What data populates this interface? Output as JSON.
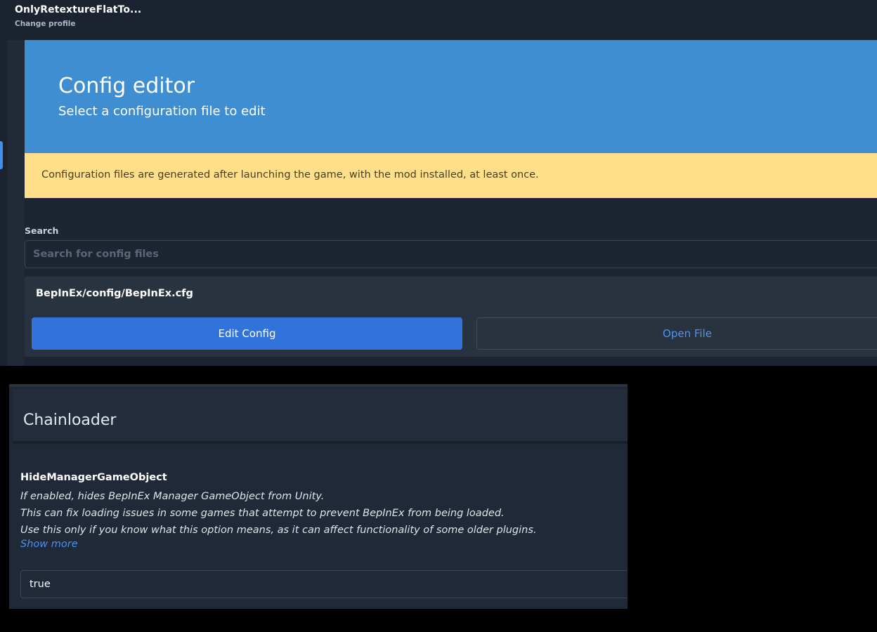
{
  "profile": {
    "name": "OnlyRetextureFlatTo...",
    "change_label": "Change profile"
  },
  "hero": {
    "title": "Config editor",
    "subtitle": "Select a configuration file to edit"
  },
  "notice": {
    "text": "Configuration files are generated after launching the game, with the mod installed, at least once."
  },
  "search": {
    "label": "Search",
    "placeholder": "Search for config files",
    "value": ""
  },
  "config_file": {
    "path": "BepInEx/config/BepInEx.cfg",
    "edit_label": "Edit Config",
    "open_label": "Open File"
  },
  "section": {
    "title": "Chainloader"
  },
  "setting": {
    "name": "HideManagerGameObject",
    "description": [
      "If enabled, hides BepInEx Manager GameObject from Unity.",
      "This can fix loading issues in some games that attempt to prevent BepInEx from being loaded.",
      "Use this only if you know what this option means, as it can affect functionality of some older plugins."
    ],
    "show_more_label": "Show more",
    "value": "true"
  },
  "colors": {
    "hero_bg": "#3f8ed2",
    "warning_bg": "#ffdf8a",
    "primary_button": "#3272db",
    "link": "#4a90f0",
    "app_bg": "#1d2532"
  }
}
